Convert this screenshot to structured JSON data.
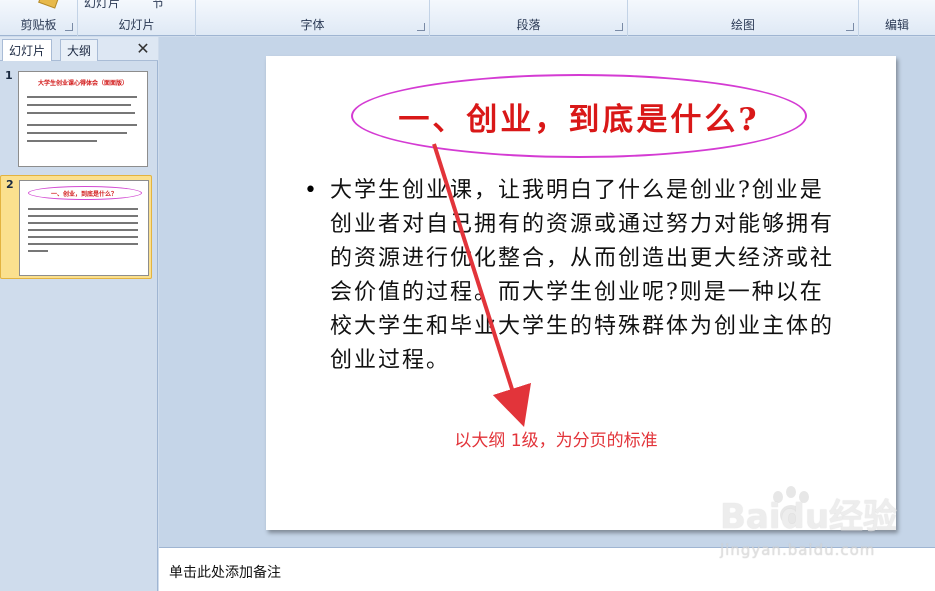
{
  "ribbon": {
    "groups": [
      {
        "label": "剪贴板"
      },
      {
        "label": "幻灯片"
      },
      {
        "label": "字体"
      },
      {
        "label": "段落"
      },
      {
        "label": "绘图"
      },
      {
        "label": "编辑"
      }
    ],
    "top_partial": {
      "slide_button": "幻灯片",
      "section_button": "节"
    }
  },
  "left_pane": {
    "tabs": [
      {
        "label": "幻灯片"
      },
      {
        "label": "大纲"
      }
    ],
    "close_glyph": "✕",
    "thumbnails": [
      {
        "number": "1",
        "title": "大学生创业课心得体会（面面版）"
      },
      {
        "number": "2",
        "title": "一、创业，到底是什么？"
      }
    ]
  },
  "slide": {
    "title": "一、创业，到底是什么?",
    "bullet": "•",
    "body": "大学生创业课，让我明白了什么是创业?创业是创业者对自己拥有的资源或通过努力对能够拥有的资源进行优化整合，从而创造出更大经济或社会价值的过程。而大学生创业呢?则是一种以在校大学生和毕业大学生的特殊群体为创业主体的创业过程。",
    "annotation": "以大纲 1级，为分页的标准"
  },
  "notes": {
    "placeholder": "单击此处添加备注"
  },
  "watermark": {
    "brand": "Baidu经验",
    "url": "jingyan.baidu.com"
  },
  "colors": {
    "title_red": "#d91818",
    "oval_magenta": "#d43bd3",
    "annotation_red": "#e2343a",
    "selected_thumb": "#fbe08e"
  }
}
